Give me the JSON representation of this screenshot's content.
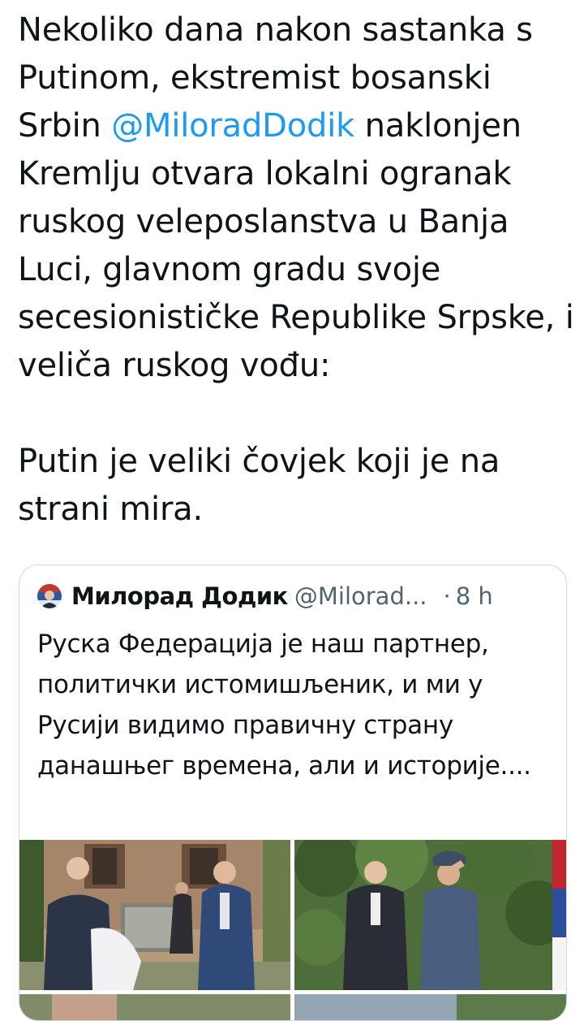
{
  "tweet": {
    "text_before_mention": "Nekoliko dana nakon sastanka s Putinom, ekstremist bosanski Srbin ",
    "mention": "@MiloradDodik",
    "text_after_mention": " naklonjen Kremlju otvara lokalni ogranak ruskog veleposlanstva u Banja Luci, glavnom gradu svoje secesionističke Republike Srpske, i veliča ruskog vođu:",
    "quote_line": "Putin je veliki čovjek koji je na strani mira."
  },
  "quoted_tweet": {
    "author_name": "Милорад Додик",
    "author_handle": "@Milorad...",
    "separator": "·",
    "time": "8 h",
    "text": "Руска Федерација је наш партнер, политички истомишљеник, и ми у Русији видимо правичну страну данашњег времена, али и историје...."
  },
  "icons": {
    "avatar": "avatar-photo",
    "media": [
      "photo-plaque-unveiling",
      "photo-officials-saluting",
      "photo-partial",
      "photo-partial"
    ]
  },
  "colors": {
    "mention": "#1d9bf0",
    "secondary_text": "#536471",
    "card_border": "#cfd9de"
  }
}
